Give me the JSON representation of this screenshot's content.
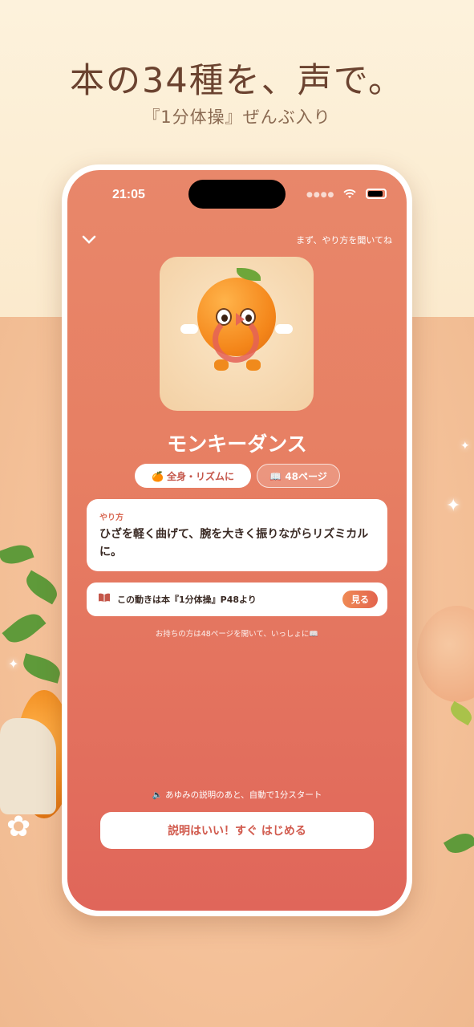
{
  "promo": {
    "headline": "本の34種を、声で。",
    "subhead": "『1分体操』ぜんぶ入り"
  },
  "status_bar": {
    "time": "21:05"
  },
  "header": {
    "back_icon": "chevron-down-icon",
    "hint": "まず、やり方を聞いてね"
  },
  "exercise": {
    "title": "モンキーダンス",
    "tags": [
      {
        "label": "🍊 全身・リズムに"
      },
      {
        "label": "📖 48ページ"
      }
    ]
  },
  "howto": {
    "label": "やり方",
    "text": "ひざを軽く曲げて、腕を大きく振りながらリズミカルに。"
  },
  "book_ref": {
    "icon": "book-icon",
    "text": "この動きは本『1分体操』P48より",
    "button_label": "見る"
  },
  "owner_hint": "お持ちの方は48ページを開いて、いっしょに📖",
  "footer": {
    "auto_note": "🔈 あゆみの説明のあと、自動で1分スタート",
    "start_label": "説明はいい！すぐ はじめる"
  },
  "colors": {
    "accent": "#e3644d",
    "screen_top": "#e8876a",
    "screen_bottom": "#e0665a"
  }
}
